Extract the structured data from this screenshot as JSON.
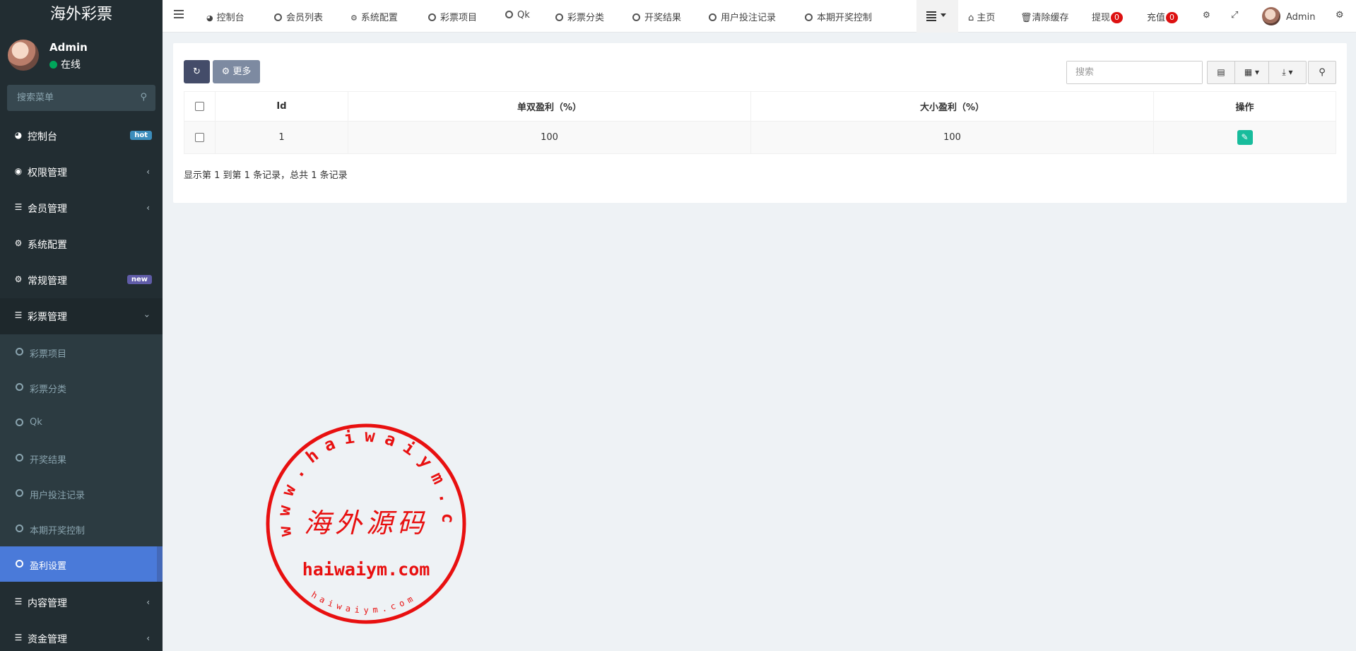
{
  "sidebar": {
    "brand": "海外彩票",
    "user": {
      "name": "Admin",
      "status": "在线"
    },
    "search_placeholder": "搜索菜单",
    "items": [
      {
        "label": "控制台",
        "badge": "hot"
      },
      {
        "label": "权限管理"
      },
      {
        "label": "会员管理"
      },
      {
        "label": "系统配置"
      },
      {
        "label": "常规管理",
        "badge": "new"
      },
      {
        "label": "彩票管理"
      }
    ],
    "sub_items": [
      {
        "label": "彩票项目"
      },
      {
        "label": "彩票分类"
      },
      {
        "label": "Qk"
      },
      {
        "label": "开奖结果"
      },
      {
        "label": "用户投注记录"
      },
      {
        "label": "本期开奖控制"
      },
      {
        "label": "盈利设置"
      }
    ],
    "items_after": [
      {
        "label": "内容管理"
      },
      {
        "label": "资金管理"
      }
    ]
  },
  "topbar": {
    "tabs": [
      {
        "label": "控制台"
      },
      {
        "label": "会员列表"
      },
      {
        "label": "系统配置"
      },
      {
        "label": "彩票项目"
      },
      {
        "label": "Qk"
      },
      {
        "label": "彩票分类"
      },
      {
        "label": "开奖结果"
      },
      {
        "label": "用户投注记录"
      },
      {
        "label": "本期开奖控制"
      }
    ],
    "home": "主页",
    "clear_cache": "清除缓存",
    "withdraw": "提现",
    "withdraw_count": "0",
    "recharge": "充值",
    "recharge_count": "0",
    "admin": "Admin"
  },
  "toolbar": {
    "more_label": "更多",
    "search_placeholder": "搜索"
  },
  "table": {
    "columns": [
      "Id",
      "单双盈利（%）",
      "大小盈利（%）",
      "操作"
    ],
    "rows": [
      {
        "id": "1",
        "odd_even": "100",
        "big_small": "100"
      }
    ],
    "page_info": "显示第 1 到第 1 条记录，总共 1 条记录"
  },
  "watermark": {
    "ring_text": "www.haiwaiym.com",
    "center_text": "海外源码",
    "domain_text": "haiwaiym.com",
    "bottom_text": "haiwaiym.com",
    "color": "#e81010"
  },
  "colors": {
    "sidebar_bg": "#222d32",
    "active_item": "#4a7ad9",
    "edit_button": "#18bc9c",
    "badge_red": "#dd1111"
  }
}
